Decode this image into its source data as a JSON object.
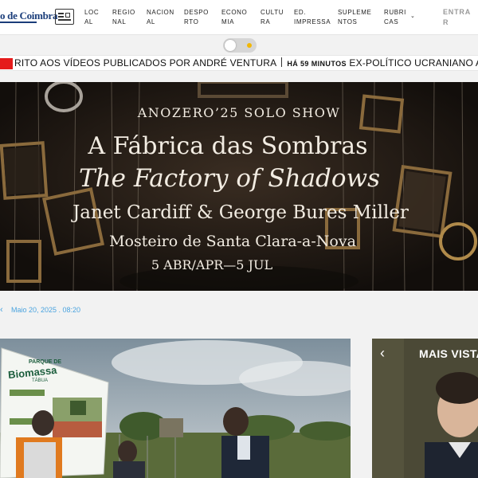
{
  "header": {
    "logo_text": "o de Coimbra",
    "nav": [
      {
        "label": "LOCAL"
      },
      {
        "label": "REGIONAL"
      },
      {
        "label": "NACIONAL"
      },
      {
        "label": "DESPORTO"
      },
      {
        "label": "ECONOMIA"
      },
      {
        "label": "CULTURA"
      },
      {
        "label": "ED. IMPRESSA"
      },
      {
        "label": "SUPLEMENTOS"
      },
      {
        "label": "RUBRICAS"
      }
    ],
    "login_label": "ENTRAR",
    "newspaper_icon": "newspaper-icon",
    "rubricas_chevron": "chevron-down-icon"
  },
  "theme_toggle": {
    "icon": "sun-icon",
    "state": "light"
  },
  "ticker": {
    "item1": "RITO AOS VÍDEOS PUBLICADOS POR ANDRÉ VENTURA",
    "time": "HÁ 59 MINUTOS",
    "item2": "EX-POLÍTICO UCRANIANO ANDRIY PORTNOV",
    "accent": "#e51b1b"
  },
  "banner": {
    "line1": "ANOZERO’25 SOLO SHOW",
    "line2": "A Fábrica das Sombras",
    "line3": "The Factory of Shadows",
    "line4": "Janet Cardiff & George Bures Miller",
    "line5": "Mosteiro de Santa Clara-a-Nova",
    "line6": "5 ABR/APR—5 JUL"
  },
  "article": {
    "date": "Maio 20, 2025 . 08:20",
    "date_color": "#4aa3df",
    "sign_small": "PARQUE DE",
    "sign_big": "Biomassa",
    "sign_tiny": "TÁBUA"
  },
  "mais_vistas": {
    "title": "MAIS VISTA",
    "prev_icon": "chevron-left-icon"
  },
  "colors": {
    "brand": "#1a3d7a",
    "accent_blue": "#4aa3df",
    "ticker_red": "#e51b1b"
  }
}
